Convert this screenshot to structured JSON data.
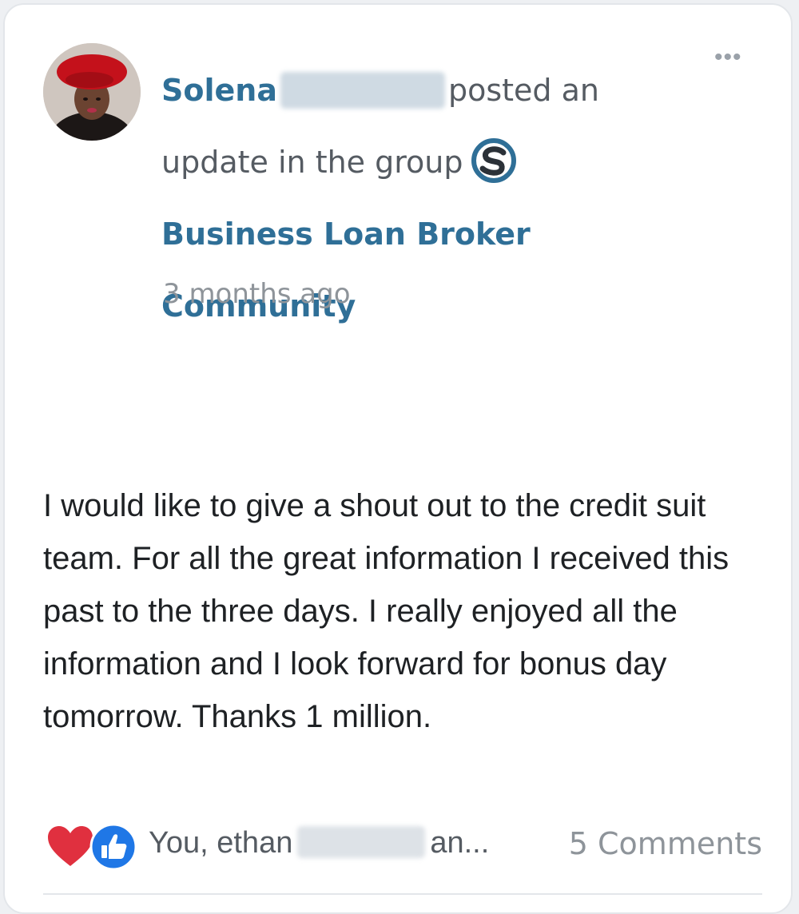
{
  "post": {
    "author_name": "Solena",
    "action_text": "posted an update in the group",
    "group_name": "Business Loan Broker Community",
    "timestamp": "3 months ago",
    "more_icon": "more-horizontal-icon",
    "body": "I would like to give a shout out to the credit suit team. For all the great information I received this past to the three days. I really enjoyed all the information and I look forward for bonus day tomorrow. Thanks 1 million."
  },
  "reactions": {
    "icons": [
      "heart-icon",
      "thumbs-up-icon"
    ],
    "reactors_prefix": "You, ethan",
    "reactors_suffix": "an...",
    "comments_label": "5 Comments"
  },
  "colors": {
    "link": "#2f6f97",
    "text": "#1e2124",
    "muted": "#8e949a",
    "heart": "#e0303f",
    "like": "#1f77e6"
  }
}
